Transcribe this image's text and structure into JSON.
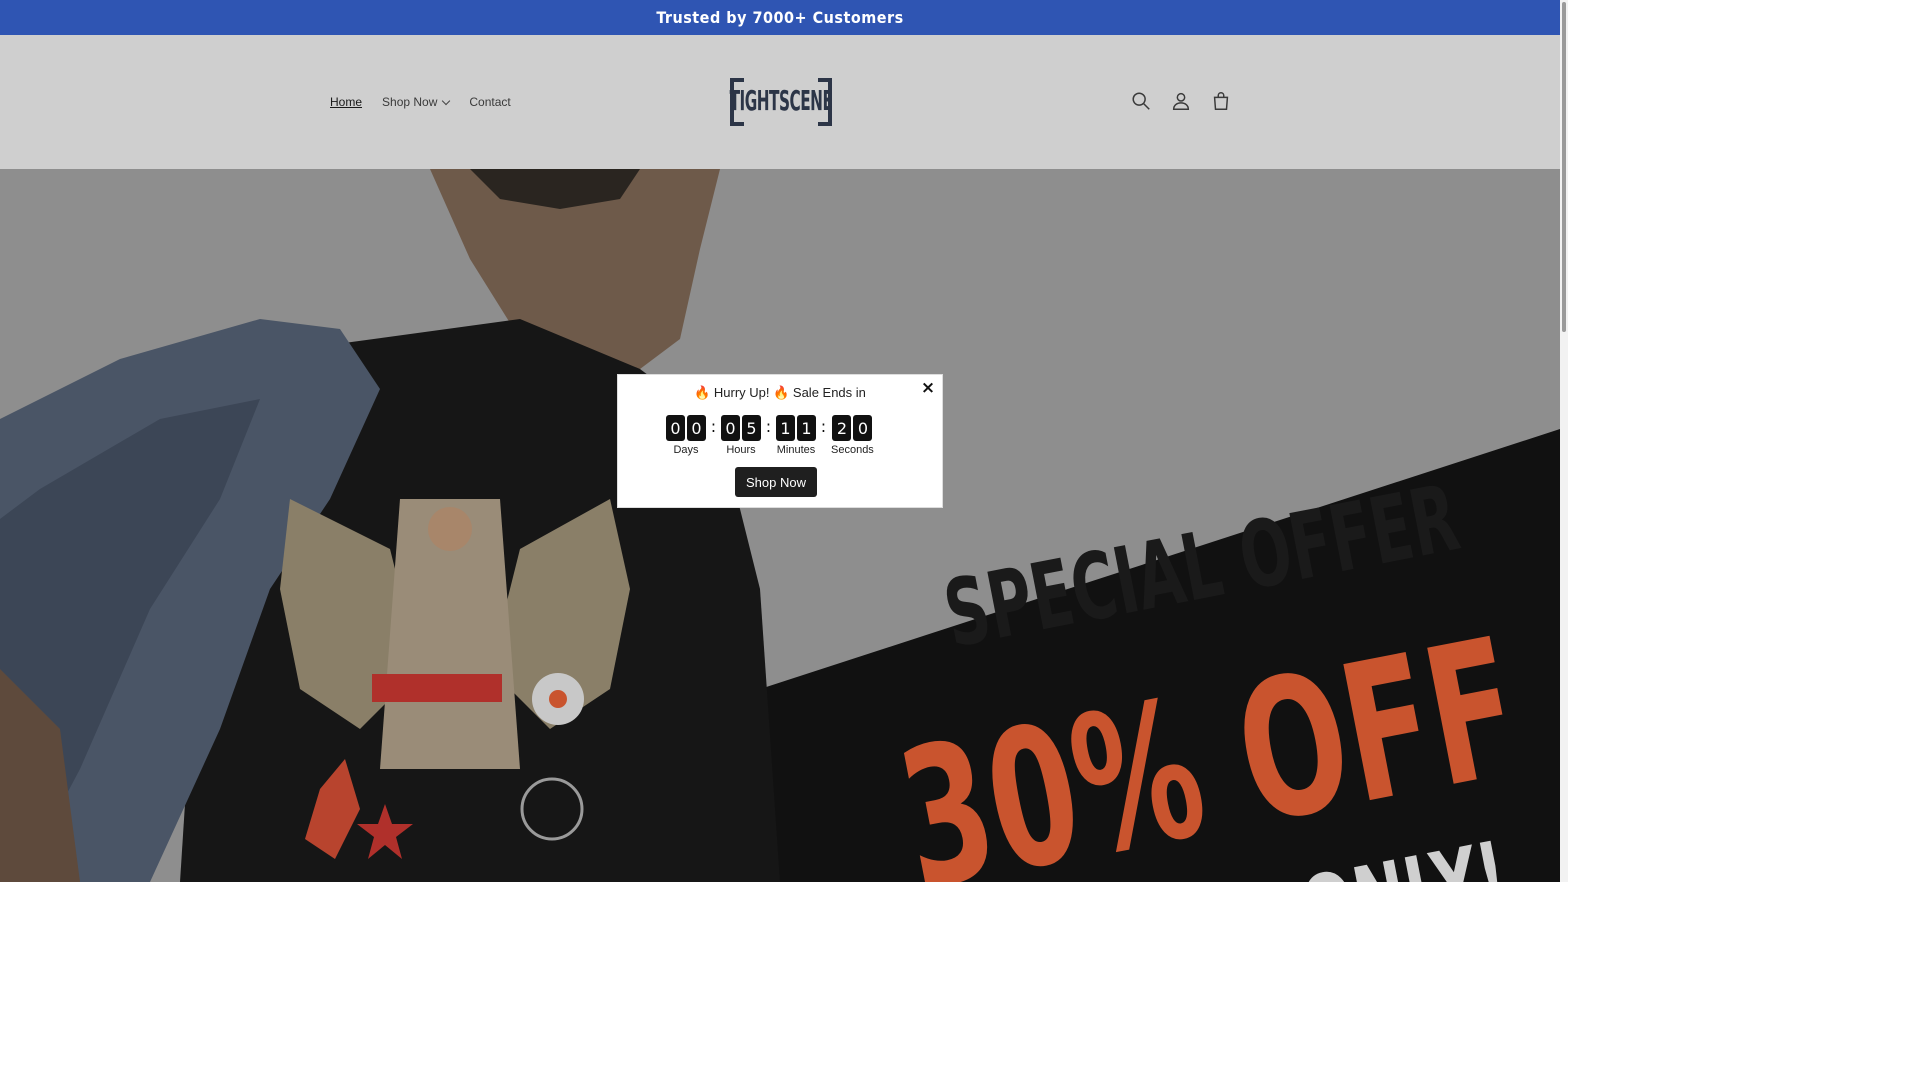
{
  "announcement": {
    "text": "Trusted by 7000+ Customers"
  },
  "nav": {
    "home": "Home",
    "shop_now": "Shop Now",
    "contact": "Contact"
  },
  "logo": {
    "text": "TIGHTSCENE"
  },
  "header_icons": [
    "search-icon",
    "account-icon",
    "cart-icon"
  ],
  "hero": {
    "offer_line1": "SPECIAL OFFER",
    "offer_line2": "30% OFF",
    "offer_line3": "EEK ONLY!"
  },
  "popup": {
    "headline": "🔥 Hurry Up! 🔥 Sale Ends in",
    "close": "×",
    "timer": {
      "days": [
        "0",
        "0"
      ],
      "hours": [
        "0",
        "5"
      ],
      "minutes": [
        "1",
        "1"
      ],
      "seconds": [
        "2",
        "0"
      ],
      "labels": {
        "days": "Days",
        "hours": "Hours",
        "minutes": "Minutes",
        "seconds": "Seconds"
      },
      "separator": ":"
    },
    "button": "Shop Now"
  },
  "colors": {
    "announcement_bg": "#2f55b3",
    "logo": "#2c3547",
    "offer_orange": "#c9542e"
  }
}
